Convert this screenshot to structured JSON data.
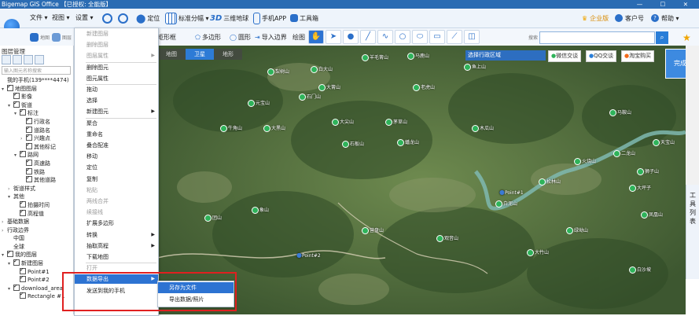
{
  "window": {
    "title": "Bigemap GIS Office 【已授权: 全能版】",
    "controls": [
      "—",
      "☐",
      "✕"
    ]
  },
  "menubar": {
    "file": "文件 ▾",
    "view": "视图 ▾",
    "settings": "设置 ▾",
    "tools": [
      {
        "label": "定位",
        "icon": "pin-icon"
      },
      {
        "label": "标准分幅 ▾",
        "icon": "grid-icon"
      },
      {
        "label": "三维地球",
        "icon": "3d-icon"
      },
      {
        "label": "手机APP",
        "icon": "phone-icon"
      },
      {
        "label": "工具箱",
        "icon": "toolbox-icon"
      }
    ],
    "right": {
      "enterprise": "企业版",
      "service": "客户号",
      "help": "帮助 ▾"
    }
  },
  "toolbar2": {
    "left_labels": [
      "地图",
      "图层"
    ],
    "rect": "矩形框",
    "polygon": "多边形",
    "circle": "圆形",
    "import_border": "导入边界",
    "draw_label": "绘图",
    "search_label": "搜索"
  },
  "layer_panel": {
    "title": "图层管理",
    "search_placeholder": "输入图元名称搜索",
    "rows": [
      {
        "indent": 0,
        "arrow": "",
        "check": "",
        "label": "我的手机(139****4474)"
      },
      {
        "indent": 0,
        "arrow": "▾",
        "check": "on",
        "label": "地图图层"
      },
      {
        "indent": 1,
        "arrow": "",
        "check": "on",
        "label": "影像"
      },
      {
        "indent": 1,
        "arrow": "▾",
        "check": "on",
        "label": "街道"
      },
      {
        "indent": 2,
        "arrow": "▾",
        "check": "on",
        "label": "标注"
      },
      {
        "indent": 3,
        "arrow": "",
        "check": "on",
        "label": "行政名"
      },
      {
        "indent": 3,
        "arrow": "",
        "check": "on",
        "label": "道路名"
      },
      {
        "indent": 3,
        "arrow": "›",
        "check": "on",
        "label": "兴趣点"
      },
      {
        "indent": 3,
        "arrow": "",
        "check": "on",
        "label": "其他标记"
      },
      {
        "indent": 2,
        "arrow": "▾",
        "check": "on",
        "label": "路网"
      },
      {
        "indent": 3,
        "arrow": "",
        "check": "on",
        "label": "高速路"
      },
      {
        "indent": 3,
        "arrow": "",
        "check": "on",
        "label": "铁路"
      },
      {
        "indent": 3,
        "arrow": "",
        "check": "on",
        "label": "其他道路"
      },
      {
        "indent": 1,
        "arrow": "›",
        "check": "",
        "label": "街道样式"
      },
      {
        "indent": 1,
        "arrow": "▾",
        "check": "",
        "label": "其他"
      },
      {
        "indent": 2,
        "arrow": "",
        "check": "on",
        "label": "拍摄时间"
      },
      {
        "indent": 2,
        "arrow": "",
        "check": "on",
        "label": "高程值"
      },
      {
        "indent": 0,
        "arrow": "›",
        "check": "",
        "label": "基础数据"
      },
      {
        "indent": 0,
        "arrow": "›",
        "check": "",
        "label": "行政边界"
      },
      {
        "indent": 1,
        "arrow": "",
        "check": "",
        "label": "中国"
      },
      {
        "indent": 1,
        "arrow": "",
        "check": "",
        "label": "全球"
      },
      {
        "indent": 0,
        "arrow": "▾",
        "check": "on",
        "label": "我的图层"
      },
      {
        "indent": 1,
        "arrow": "▾",
        "check": "on",
        "label": "新建图层"
      },
      {
        "indent": 2,
        "arrow": "",
        "check": "on",
        "label": "Point#1"
      },
      {
        "indent": 2,
        "arrow": "",
        "check": "on",
        "label": "Point#2"
      },
      {
        "indent": 1,
        "arrow": "▾",
        "check": "on",
        "label": "download_area"
      },
      {
        "indent": 2,
        "arrow": "",
        "check": "on",
        "label": "Rectangle #1"
      }
    ]
  },
  "context_menu": {
    "items": [
      {
        "label": "新建图层",
        "disabled": true,
        "sub": false
      },
      {
        "label": "删除图层",
        "disabled": true,
        "sub": false
      },
      {
        "label": "图层属性",
        "disabled": true,
        "sub": true
      },
      {
        "label": "删除图元",
        "disabled": false,
        "sub": false
      },
      {
        "label": "图元属性",
        "disabled": false,
        "sub": false
      },
      {
        "label": "拖动",
        "disabled": false,
        "sub": false
      },
      {
        "label": "选择",
        "disabled": false,
        "sub": false
      },
      {
        "label": "新建图元",
        "disabled": false,
        "sub": true
      },
      {
        "label": "聚合",
        "disabled": false,
        "sub": false
      },
      {
        "label": "重命名",
        "disabled": false,
        "sub": false
      },
      {
        "label": "叠合配准",
        "disabled": false,
        "sub": false
      },
      {
        "label": "移动",
        "disabled": false,
        "sub": false
      },
      {
        "label": "定位",
        "disabled": false,
        "sub": false
      },
      {
        "label": "复制",
        "disabled": false,
        "sub": false
      },
      {
        "label": "粘贴",
        "disabled": true,
        "sub": false
      },
      {
        "label": "两线合并",
        "disabled": true,
        "sub": false
      },
      {
        "label": "续接线",
        "disabled": true,
        "sub": false
      },
      {
        "label": "扩展多边形",
        "disabled": false,
        "sub": false
      },
      {
        "label": "转换",
        "disabled": false,
        "sub": true
      },
      {
        "label": "抽取高程",
        "disabled": false,
        "sub": true
      },
      {
        "label": "下载地图",
        "disabled": false,
        "sub": false
      },
      {
        "label": "打开",
        "disabled": true,
        "sub": false
      },
      {
        "label": "数据导出",
        "disabled": false,
        "sub": true,
        "highlight": true
      },
      {
        "label": "发送到我的手机",
        "disabled": false,
        "sub": false
      }
    ]
  },
  "submenu": {
    "items": [
      {
        "label": "另存为文件",
        "highlight": true
      },
      {
        "label": "导出数据/照片",
        "highlight": false
      }
    ]
  },
  "map": {
    "tabs": [
      {
        "label": "地图",
        "active": false
      },
      {
        "label": "卫星",
        "active": true
      },
      {
        "label": "地形",
        "active": false
      }
    ],
    "region_select": "选择行政区域",
    "share": [
      "微信交谈",
      "QQ交谈",
      "淘宝购买"
    ],
    "done": "完成",
    "right_tool": [
      "工",
      "具",
      "列",
      "表"
    ],
    "pois": [
      {
        "label": "马鹿山"
      },
      {
        "label": "羊毛箐山"
      },
      {
        "label": "白大山"
      },
      {
        "label": "鱼上山"
      },
      {
        "label": "梨树山"
      },
      {
        "label": "大箐山"
      },
      {
        "label": "老虎山"
      },
      {
        "label": "石门山"
      },
      {
        "label": "元宝山"
      },
      {
        "label": "大尖山"
      },
      {
        "label": "茅草山"
      },
      {
        "label": "木瓜山"
      },
      {
        "label": "牛角山"
      },
      {
        "label": "大黑山"
      },
      {
        "label": "石板山"
      },
      {
        "label": "蟠龙山"
      },
      {
        "label": "马鞍山"
      },
      {
        "label": "火烧山"
      },
      {
        "label": "二龙山"
      },
      {
        "label": "天宝山"
      },
      {
        "label": "狮子山"
      },
      {
        "label": "白泥山"
      },
      {
        "label": "松林山"
      },
      {
        "label": "大坪子"
      },
      {
        "label": "凤凰山"
      },
      {
        "label": "绿坳山"
      },
      {
        "label": "大竹山"
      },
      {
        "label": "观音山"
      },
      {
        "label": "团山"
      },
      {
        "label": "象山"
      },
      {
        "label": "营盘山"
      },
      {
        "label": "白沙坡"
      }
    ],
    "points": [
      "Point#1",
      "Point#2"
    ],
    "rectangle": "Rectangle #1"
  },
  "colors": {
    "titlebar": "#2b6cb3",
    "accent": "#2d73d2",
    "redbox": "#e02020"
  }
}
